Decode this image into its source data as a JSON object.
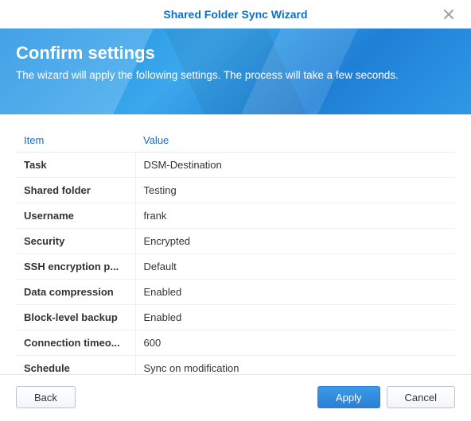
{
  "window": {
    "title": "Shared Folder Sync Wizard"
  },
  "banner": {
    "heading": "Confirm settings",
    "description": "The wizard will apply the following settings. The process will take a few seconds."
  },
  "table": {
    "headers": {
      "item": "Item",
      "value": "Value"
    },
    "rows": [
      {
        "item": "Task",
        "value": "DSM-Destination"
      },
      {
        "item": "Shared folder",
        "value": "Testing"
      },
      {
        "item": "Username",
        "value": "frank"
      },
      {
        "item": "Security",
        "value": "Encrypted"
      },
      {
        "item": "SSH encryption p...",
        "value": "Default"
      },
      {
        "item": "Data compression",
        "value": "Enabled"
      },
      {
        "item": "Block-level backup",
        "value": "Enabled"
      },
      {
        "item": "Connection timeo...",
        "value": "600"
      },
      {
        "item": "Schedule",
        "value": "Sync on modification"
      }
    ]
  },
  "buttons": {
    "back": "Back",
    "apply": "Apply",
    "cancel": "Cancel"
  }
}
